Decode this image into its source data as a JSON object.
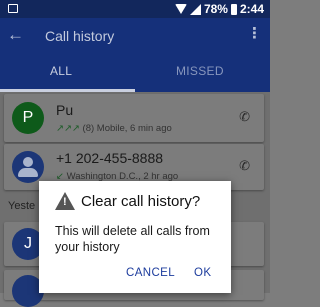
{
  "status_bar": {
    "battery": "78%",
    "time": "2:44"
  },
  "app_bar": {
    "title": "Call history"
  },
  "tabs": [
    {
      "label": "ALL"
    },
    {
      "label": "MISSED"
    }
  ],
  "calls": [
    {
      "avatar_letter": "P",
      "name": "Pu",
      "arrows": "↗↗↗",
      "details": "(8) Mobile, 6 min ago"
    },
    {
      "name": "+1 202-455-8888",
      "arrows": "↙",
      "details": "Washington D.C., 2 hr ago"
    }
  ],
  "section_label": "Yeste",
  "partial_avatar_letter": "J",
  "dialog": {
    "title": "Clear call history?",
    "message": "This will delete all calls from your history",
    "cancel_label": "CANCEL",
    "ok_label": "OK"
  }
}
